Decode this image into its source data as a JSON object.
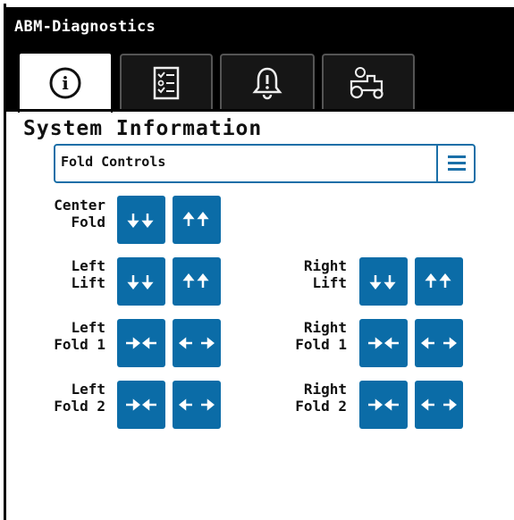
{
  "app_title": "ABM-Diagnostics",
  "tabs": [
    {
      "name": "info",
      "icon": "info-icon",
      "active": true
    },
    {
      "name": "checklist",
      "icon": "checklist-icon",
      "active": false
    },
    {
      "name": "alarms",
      "icon": "bell-icon",
      "active": false
    },
    {
      "name": "machine",
      "icon": "tractor-icon",
      "active": false
    }
  ],
  "page_title": "System Information",
  "dropdown": {
    "value": "Fold Controls",
    "icon": "menu-icon"
  },
  "accent_color": "#0b6ca7",
  "controls": {
    "center_fold": {
      "label": "Center\nFold",
      "buttons": [
        "down-down",
        "up-up"
      ]
    },
    "left_lift": {
      "label": "Left\nLift",
      "buttons": [
        "down-down",
        "up-up"
      ]
    },
    "right_lift": {
      "label": "Right\nLift",
      "buttons": [
        "down-down",
        "up-up"
      ]
    },
    "left_fold_1": {
      "label": "Left\nFold 1",
      "buttons": [
        "fold-in",
        "fold-out"
      ]
    },
    "right_fold_1": {
      "label": "Right\nFold 1",
      "buttons": [
        "fold-in",
        "fold-out"
      ]
    },
    "left_fold_2": {
      "label": "Left\nFold 2",
      "buttons": [
        "fold-in",
        "fold-out"
      ]
    },
    "right_fold_2": {
      "label": "Right\nFold 2",
      "buttons": [
        "fold-in",
        "fold-out"
      ]
    }
  }
}
